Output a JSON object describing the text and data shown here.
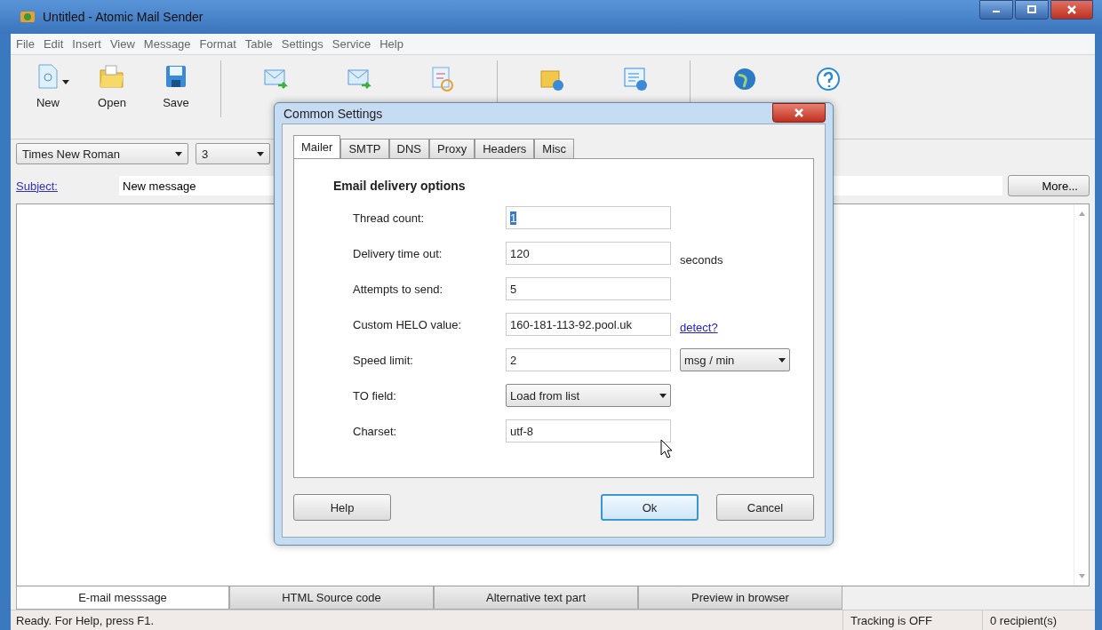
{
  "window": {
    "title": "Untitled - Atomic Mail Sender"
  },
  "menu": [
    "File",
    "Edit",
    "Insert",
    "View",
    "Message",
    "Format",
    "Table",
    "Settings",
    "Service",
    "Help"
  ],
  "toolbar": [
    {
      "label": "New",
      "dropdown": true
    },
    {
      "label": "Open"
    },
    {
      "label": "Save"
    }
  ],
  "format_bar": {
    "font": "Times New Roman",
    "size": "3"
  },
  "subject": {
    "label": "Subject:",
    "value": "New message"
  },
  "more_button": "More...",
  "dialog": {
    "title": "Common Settings",
    "tabs": [
      {
        "label": "Mailer",
        "selected": true
      },
      {
        "label": "SMTP",
        "selected": false
      },
      {
        "label": "DNS",
        "selected": false
      },
      {
        "label": "Proxy",
        "selected": false
      },
      {
        "label": "Headers",
        "selected": false
      },
      {
        "label": "Misc",
        "selected": false
      }
    ],
    "section": "Email delivery options",
    "fields": [
      {
        "label": "Thread count:",
        "kind": "text",
        "value": "1",
        "highlighted": true
      },
      {
        "label": "Delivery time out:",
        "kind": "text",
        "value": "120",
        "highlighted": false,
        "suffix": "seconds"
      },
      {
        "label": "Attempts to send:",
        "kind": "text",
        "value": "5",
        "highlighted": false
      },
      {
        "label": "Custom HELO value:",
        "kind": "text",
        "value": "160-181-113-92.pool.uk",
        "highlighted": false,
        "link": "detect?"
      },
      {
        "label": "Speed limit:",
        "kind": "text",
        "value": "2",
        "highlighted": false,
        "unit": "msg / min"
      },
      {
        "label": "TO field:",
        "kind": "select",
        "value": "Load from list"
      },
      {
        "label": "Charset:",
        "kind": "text",
        "value": "utf-8",
        "highlighted": false
      }
    ],
    "buttons": [
      {
        "label": "Help",
        "default": false
      },
      {
        "label": "Ok",
        "default": true
      },
      {
        "label": "Cancel",
        "default": false
      }
    ]
  },
  "editor_tabs": [
    {
      "label": "E-mail messsage",
      "selected": true
    },
    {
      "label": "HTML Source code",
      "selected": false
    },
    {
      "label": "Alternative text part",
      "selected": false
    },
    {
      "label": "Preview in browser",
      "selected": false
    }
  ],
  "status_bar": {
    "message": "Ready. For Help, press F1.",
    "tracking": "Tracking is OFF",
    "recipients": "0 recipient(s)"
  }
}
